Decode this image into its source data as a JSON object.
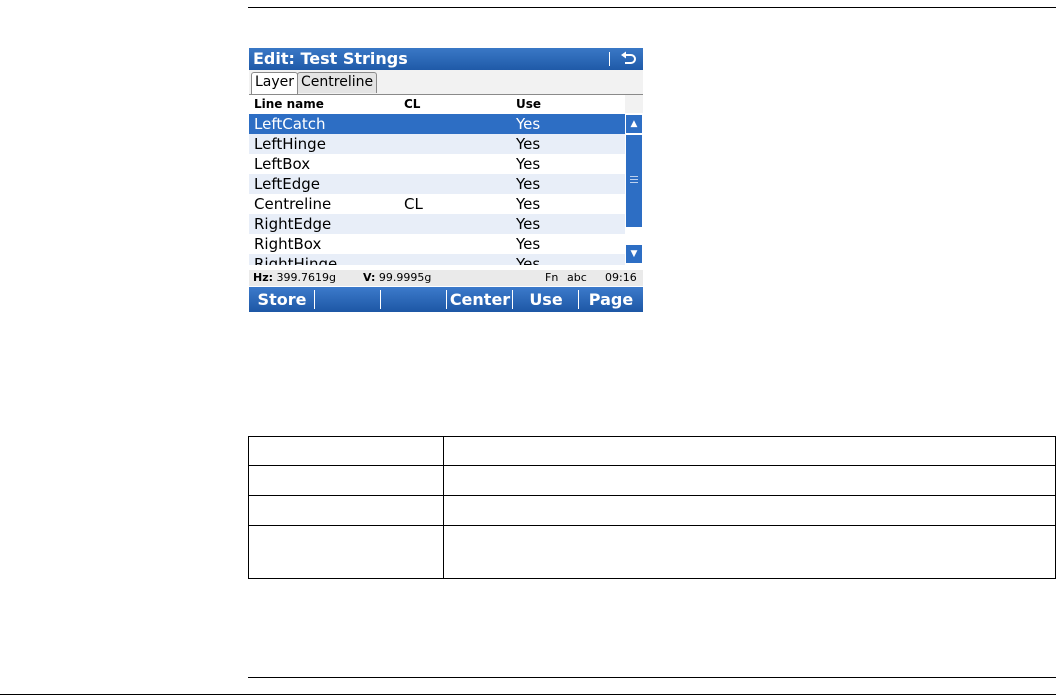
{
  "screen": {
    "title": "Edit: Test Strings",
    "tabs": [
      "Layer",
      "Centreline"
    ],
    "columns": {
      "name": "Line name",
      "cl": "CL",
      "use": "Use"
    },
    "rows": [
      {
        "name": "LeftCatch",
        "cl": "",
        "use": "Yes"
      },
      {
        "name": "LeftHinge",
        "cl": "",
        "use": "Yes"
      },
      {
        "name": "LeftBox",
        "cl": "",
        "use": "Yes"
      },
      {
        "name": "LeftEdge",
        "cl": "",
        "use": "Yes"
      },
      {
        "name": "Centreline",
        "cl": "CL",
        "use": "Yes"
      },
      {
        "name": "RightEdge",
        "cl": "",
        "use": "Yes"
      },
      {
        "name": "RightBox",
        "cl": "",
        "use": "Yes"
      },
      {
        "name": "RightHinge",
        "cl": "",
        "use": "Yes"
      }
    ],
    "selected_row": 0,
    "status": {
      "hz_label": "Hz:",
      "hz_value": "399.7619g",
      "v_label": "V:",
      "v_value": "99.9995g",
      "fn": "Fn",
      "input_mode": "abc",
      "time": "09:16"
    },
    "softkeys": [
      "Store",
      "",
      "",
      "Center",
      "Use",
      "Page"
    ],
    "colors": {
      "title_bar": "#2d6ec4",
      "selection": "#2d6ec4",
      "alt_row": "#e8eef8"
    },
    "icons": {
      "back": "back-arrow-icon",
      "scroll_up": "triangle-up-icon",
      "scroll_down": "triangle-down-icon"
    }
  },
  "doc_table": {
    "headers": [
      "",
      ""
    ],
    "rows": [
      [
        "",
        ""
      ],
      [
        "",
        ""
      ],
      [
        "",
        ""
      ]
    ]
  }
}
